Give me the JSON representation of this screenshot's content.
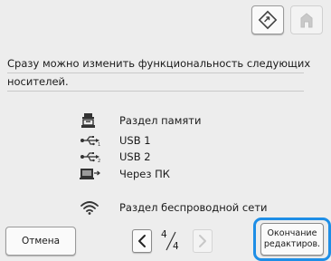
{
  "message": {
    "line1": "Сразу можно изменить функциональность следующих",
    "line2": "носителей."
  },
  "media_list": [
    {
      "icon": "machine-memory-icon",
      "label": "Раздел памяти"
    },
    {
      "icon": "usb-icon",
      "label": "USB 1"
    },
    {
      "icon": "usb-icon",
      "label": "USB 2"
    },
    {
      "icon": "pc-icon",
      "label": "Через ПК"
    },
    {
      "icon": "wireless-icon",
      "label": "Раздел беспроводной сети"
    }
  ],
  "bottom_bar": {
    "cancel_label": "Отмена",
    "page_current": "4",
    "page_total": "4",
    "done_label_line1": "Окончание",
    "done_label_line2": "редактиров."
  },
  "colors": {
    "background": "#ededed",
    "highlight": "#1e8ee6",
    "disabled_icon": "#c4c4c4"
  }
}
